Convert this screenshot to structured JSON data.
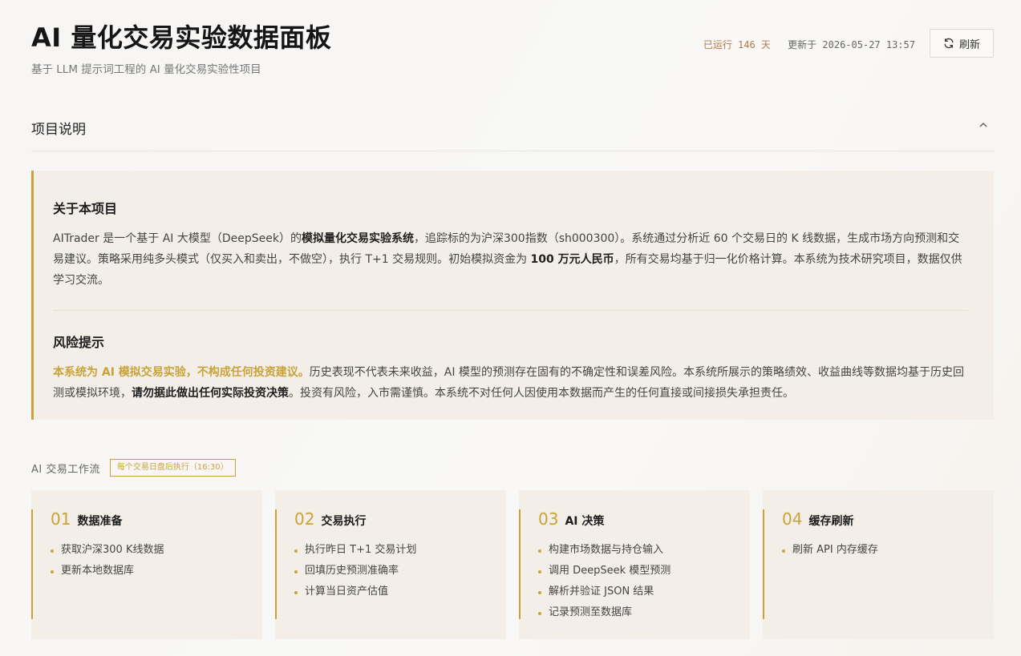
{
  "header": {
    "title": "AI 量化交易实验数据面板",
    "subtitle": "基于 LLM 提示词工程的 AI 量化交易实验性项目",
    "running": "已运行 146 天",
    "updated": "更新于 2026-05-27 13:57",
    "refresh_label": "刷新",
    "refresh_icon": "refresh-icon"
  },
  "project": {
    "section_title": "项目说明",
    "about_title": "关于本项目",
    "about_p1": "AITrader 是一个基于 AI 大模型（DeepSeek）的",
    "about_b1": "模拟量化交易实验系统",
    "about_p2": "，追踪标的为沪深300指数（sh000300）。系统通过分析近 60 个交易日的 K 线数据，生成市场方向预测和交易建议。策略采用纯多头模式（仅买入和卖出，不做空），执行 T+1 交易规则。初始模拟资金为 ",
    "about_b2": "100 万元人民币",
    "about_p3": "，所有交易均基于归一化价格计算。本系统为技术研究项目，数据仅供学习交流。",
    "risk_title": "风险提示",
    "risk_warn": "本系统为 AI 模拟交易实验，不构成任何投资建议。",
    "risk_p1": "历史表现不代表未来收益，AI 模型的预测存在固有的不确定性和误差风险。本系统所展示的策略绩效、收益曲线等数据均基于历史回测或模拟环境，",
    "risk_b1": "请勿据此做出任何实际投资决策",
    "risk_p2": "。投资有风险，入市需谨慎。本系统不对任何人因使用本数据而产生的任何直接或间接损失承担责任。"
  },
  "workflow": {
    "label": "AI 交易工作流",
    "badge": "每个交易日盘后执行（16:30）",
    "steps": [
      {
        "num": "01",
        "title": "数据准备",
        "items": [
          "获取沪深300 K线数据",
          "更新本地数据库"
        ]
      },
      {
        "num": "02",
        "title": "交易执行",
        "items": [
          "执行昨日 T+1 交易计划",
          "回填历史预测准确率",
          "计算当日资产估值"
        ]
      },
      {
        "num": "03",
        "title": "AI 决策",
        "items": [
          "构建市场数据与持仓输入",
          "调用 DeepSeek 模型预测",
          "解析并验证 JSON 结果",
          "记录预测至数据库"
        ]
      },
      {
        "num": "04",
        "title": "缓存刷新",
        "items": [
          "刷新 API 内存缓存"
        ]
      }
    ]
  },
  "colors": {
    "accent": "#c9a23b",
    "panel": "#f3efe8",
    "running": "#b07a44"
  }
}
